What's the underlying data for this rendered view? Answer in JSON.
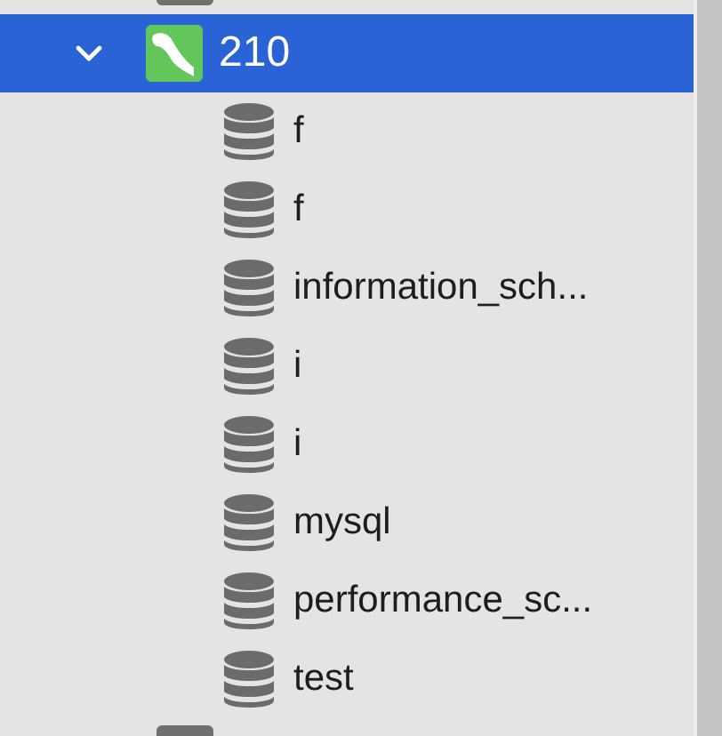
{
  "tree": {
    "nodes": [
      {
        "label": "210",
        "kind": "server",
        "expanded": true,
        "selected": true,
        "children": [
          {
            "label": "f",
            "kind": "database",
            "selected": false
          },
          {
            "label": "f",
            "kind": "database",
            "selected": false
          },
          {
            "label": "information_sch...",
            "kind": "database",
            "selected": false
          },
          {
            "label": "i",
            "kind": "database",
            "selected": false
          },
          {
            "label": "i",
            "kind": "database",
            "selected": false
          },
          {
            "label": "mysql",
            "kind": "database",
            "selected": false
          },
          {
            "label": "performance_sc...",
            "kind": "database",
            "selected": false
          },
          {
            "label": "test",
            "kind": "database",
            "selected": false
          }
        ]
      }
    ]
  }
}
